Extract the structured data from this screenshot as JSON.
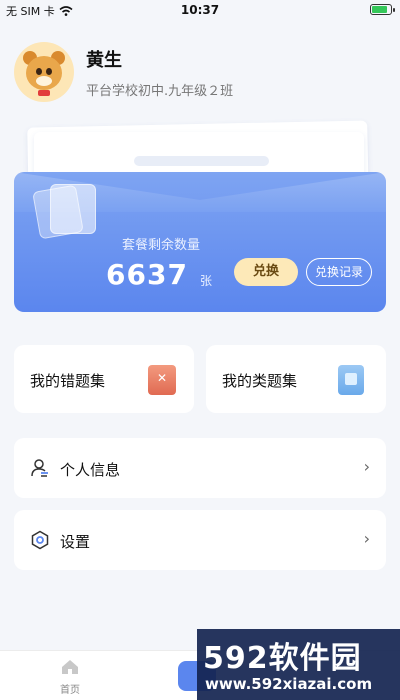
{
  "status_bar": {
    "carrier": "无 SIM 卡",
    "time": "10:37"
  },
  "profile": {
    "name": "黄生",
    "school": "平台学校初中.九年级２班"
  },
  "package": {
    "label": "套餐剩余数量",
    "count": "6637",
    "unit": "张",
    "exchange_label": "兑换",
    "record_label": "兑换记录"
  },
  "tiles": [
    {
      "label": "我的错题集",
      "icon": "wrong-questions-icon"
    },
    {
      "label": "我的类题集",
      "icon": "similar-questions-icon"
    }
  ],
  "menu": [
    {
      "label": "个人信息",
      "icon": "person-icon"
    },
    {
      "label": "设置",
      "icon": "settings-hexagon-icon"
    }
  ],
  "bottom_nav": {
    "home_label": "首页"
  },
  "watermark": {
    "title": "592软件园",
    "url": "www.592xiazai.com"
  },
  "colors": {
    "accent": "#5b86ee",
    "exchange_button": "#fde9b8",
    "background": "#f4f6fa"
  }
}
